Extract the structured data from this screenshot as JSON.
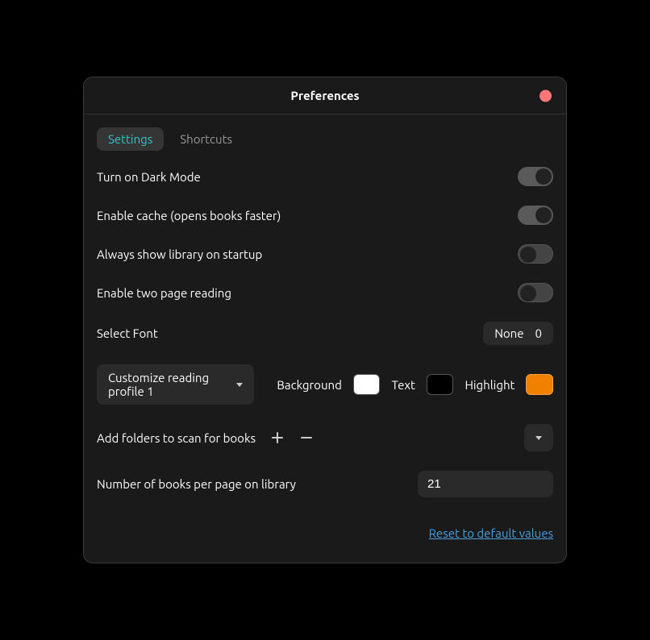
{
  "title": "Preferences",
  "tabs": {
    "settings": "Settings",
    "shortcuts": "Shortcuts"
  },
  "rows": {
    "dark_mode": "Turn on Dark Mode",
    "cache": "Enable cache (opens books faster)",
    "library_startup": "Always show library on startup",
    "two_page": "Enable two page reading",
    "select_font": "Select Font",
    "add_folders": "Add folders to scan for books",
    "books_per_page": "Number of books per page on library"
  },
  "font": {
    "name": "None",
    "size": "0"
  },
  "profile": {
    "label": "Customize reading profile 1"
  },
  "colors": {
    "background_label": "Background",
    "text_label": "Text",
    "highlight_label": "Highlight",
    "background": "#ffffff",
    "text": "#000000",
    "highlight": "#f08000"
  },
  "books_per_page_value": "21",
  "reset_label": "Reset to default values",
  "toggles": {
    "dark_mode": true,
    "cache": true,
    "library_startup": false,
    "two_page": false
  }
}
